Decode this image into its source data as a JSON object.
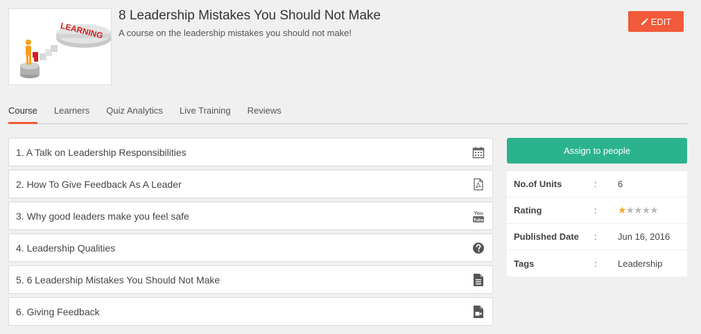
{
  "course": {
    "title": "8 Leadership Mistakes You Should Not Make",
    "subtitle": "A course on the leadership mistakes you should not make!",
    "thumbnail_text": "LEARNING"
  },
  "header": {
    "edit_label": "EDIT"
  },
  "tabs": [
    {
      "label": "Course",
      "active": true
    },
    {
      "label": "Learners",
      "active": false
    },
    {
      "label": "Quiz Analytics",
      "active": false
    },
    {
      "label": "Live Training",
      "active": false
    },
    {
      "label": "Reviews",
      "active": false
    }
  ],
  "units": [
    {
      "label": "1. A Talk on Leadership Responsibilities",
      "icon": "calendar-icon"
    },
    {
      "label": "2. How To Give Feedback As A Leader",
      "icon": "pdf-icon"
    },
    {
      "label": "3. Why good leaders make you feel safe",
      "icon": "youtube-icon"
    },
    {
      "label": "4. Leadership Qualities",
      "icon": "question-icon"
    },
    {
      "label": "5. 6 Leadership Mistakes You Should Not Make",
      "icon": "document-icon"
    },
    {
      "label": "6. Giving Feedback",
      "icon": "video-icon"
    }
  ],
  "sidebar": {
    "assign_label": "Assign to people",
    "info": {
      "units_key": "No.of Units",
      "units_val": "6",
      "rating_key": "Rating",
      "rating_value": 1,
      "rating_max": 5,
      "published_key": "Published Date",
      "published_val": "Jun 16, 2016",
      "tags_key": "Tags",
      "tags_val": "Leadership",
      "separator": ":"
    }
  },
  "colors": {
    "accent": "#f15a3a",
    "assign": "#2bb38e",
    "star": "#f5a623"
  }
}
